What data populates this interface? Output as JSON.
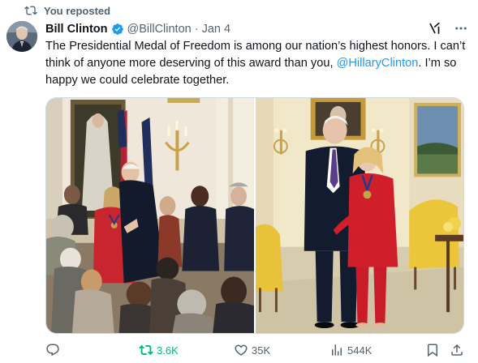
{
  "repost_banner": {
    "text": "You reposted",
    "icon": "repost-icon"
  },
  "author": {
    "name": "Bill Clinton",
    "handle": "@BillClinton",
    "separator": "·",
    "date": "Jan 4",
    "verified": true
  },
  "tweet": {
    "text_before_mention": "The Presidential Medal of Freedom is among our nation’s highest honors. I can’t think of anyone more deserving of this award than you, ",
    "mention": "@HillaryClinton",
    "text_after_mention": ". I’m so happy we could celebrate together."
  },
  "media": {
    "count": 2
  },
  "actions": {
    "reply": {
      "icon": "reply-icon",
      "count": ""
    },
    "repost": {
      "icon": "repost-icon",
      "count": "3.6K",
      "color": "#00ba7c",
      "active": true
    },
    "like": {
      "icon": "heart-icon",
      "count": "35K"
    },
    "views": {
      "icon": "views-icon",
      "count": "544K"
    },
    "bookmark": {
      "icon": "bookmark-icon"
    },
    "share": {
      "icon": "share-icon"
    }
  },
  "colors": {
    "accent": "#1d9bf0",
    "secondary_text": "#536471",
    "primary_text": "#0f1419",
    "repost_active": "#00ba7c"
  }
}
